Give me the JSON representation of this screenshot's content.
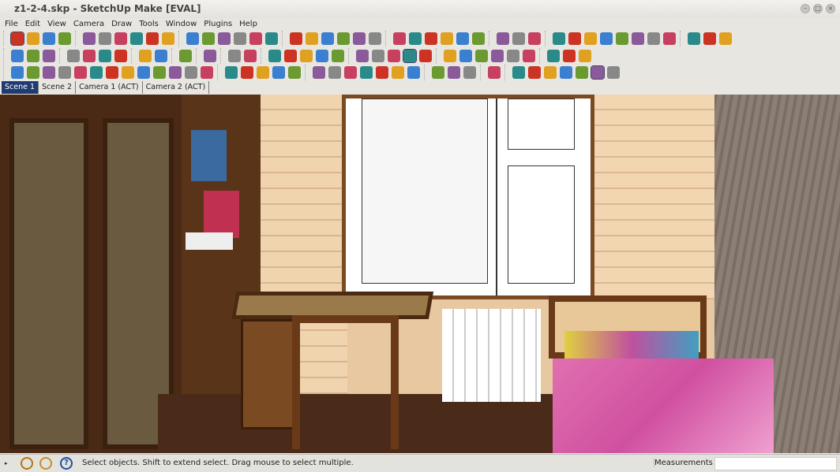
{
  "window": {
    "title": "z1-2-4.skp - SketchUp Make [EVAL]"
  },
  "menu": [
    "File",
    "Edit",
    "View",
    "Camera",
    "Draw",
    "Tools",
    "Window",
    "Plugins",
    "Help"
  ],
  "toolbars": [
    [
      [
        "select-icon",
        "component-icon",
        "paint-bucket-icon",
        "eraser-icon"
      ],
      [
        "rectangle-icon",
        "line-icon",
        "circle-icon",
        "arc-icon",
        "polygon-icon",
        "freehand-icon"
      ],
      [
        "move-icon",
        "push-pull-icon",
        "rotate-icon",
        "follow-me-icon",
        "scale-icon",
        "offset-icon"
      ],
      [
        "tape-measure-icon",
        "dimension-icon",
        "protractor-icon",
        "text-icon",
        "axes-icon",
        "3d-text-icon"
      ],
      [
        "orbit-icon",
        "pan-icon",
        "zoom-icon",
        "zoom-window-icon",
        "zoom-extents-icon",
        "previous-view-icon"
      ],
      [
        "position-camera-icon",
        "walk-icon",
        "look-around-icon"
      ],
      [
        "section-plane-icon",
        "display-section-planes-icon",
        "display-section-cuts-icon",
        "sandbox-icon",
        "smoove-icon",
        "stamp-icon",
        "drape-icon",
        "add-detail-icon"
      ],
      [
        "get-models-icon",
        "share-model-icon",
        "share-component-icon"
      ]
    ],
    [
      [
        "new-icon",
        "open-icon",
        "save-icon"
      ],
      [
        "cut-icon",
        "copy-icon",
        "paste-icon",
        "erase-icon"
      ],
      [
        "undo-icon",
        "redo-icon"
      ],
      [
        "print-icon"
      ],
      [
        "model-info-icon"
      ],
      [
        "iso-view-icon",
        "xray-icon"
      ],
      [
        "top-view-icon",
        "front-view-icon",
        "right-view-icon",
        "back-view-icon",
        "left-view-icon"
      ],
      [
        "wireframe-icon",
        "hidden-line-icon",
        "shaded-icon",
        "shaded-textures-icon",
        "monochrome-icon"
      ],
      [
        "layer-icon-1",
        "layer-icon-2",
        "layer-icon-3",
        "layer-icon-4",
        "layer-icon-5",
        "layer-icon-6"
      ],
      [
        "photo-texture-icon",
        "solid-tools-icon",
        "outer-shell-icon"
      ]
    ],
    [
      [
        "bezier-icon",
        "polyline-icon",
        "spiral-icon",
        "catenary-icon",
        "arc-3pt-icon",
        "arc-2pt-icon",
        "spline-icon",
        "freehand-curve-icon",
        "fillet-icon",
        "arc-icon-2",
        "rect-curve-icon",
        "nurbs-icon",
        "arc-icon-3"
      ],
      [
        "curve-edit-icon",
        "polygon-curve-icon",
        "tool-wrench-icon",
        "ellipse-icon",
        "parabola-icon"
      ],
      [
        "shadow-icon",
        "sphere-icon",
        "sphere-shaded-icon",
        "disk-icon",
        "cone-icon",
        "hand-icon",
        "torus-icon"
      ],
      [
        "joint-push-pull-icon",
        "vector-push-pull-icon",
        "normal-push-pull-icon"
      ],
      [
        "script-icon"
      ],
      [
        "render-icon-1",
        "render-icon-2",
        "render-icon-3",
        "render-icon-4",
        "paint-tool-icon",
        "render-active-icon",
        "film-strip-icon"
      ]
    ]
  ],
  "colors": [
    "#cc3322",
    "#e0a020",
    "#3a7fd0",
    "#6a9a30",
    "#8a5a9a",
    "#888888",
    "#c84060",
    "#2a8a8a"
  ],
  "tabs": [
    "Scene 1",
    "Scene 2",
    "Camera 1 (ACT)",
    "Camera 2 (ACT)"
  ],
  "status": {
    "message": "Select objects. Shift to extend select. Drag mouse to select multiple.",
    "measurements_label": "Measurements",
    "measurements_value": ""
  }
}
